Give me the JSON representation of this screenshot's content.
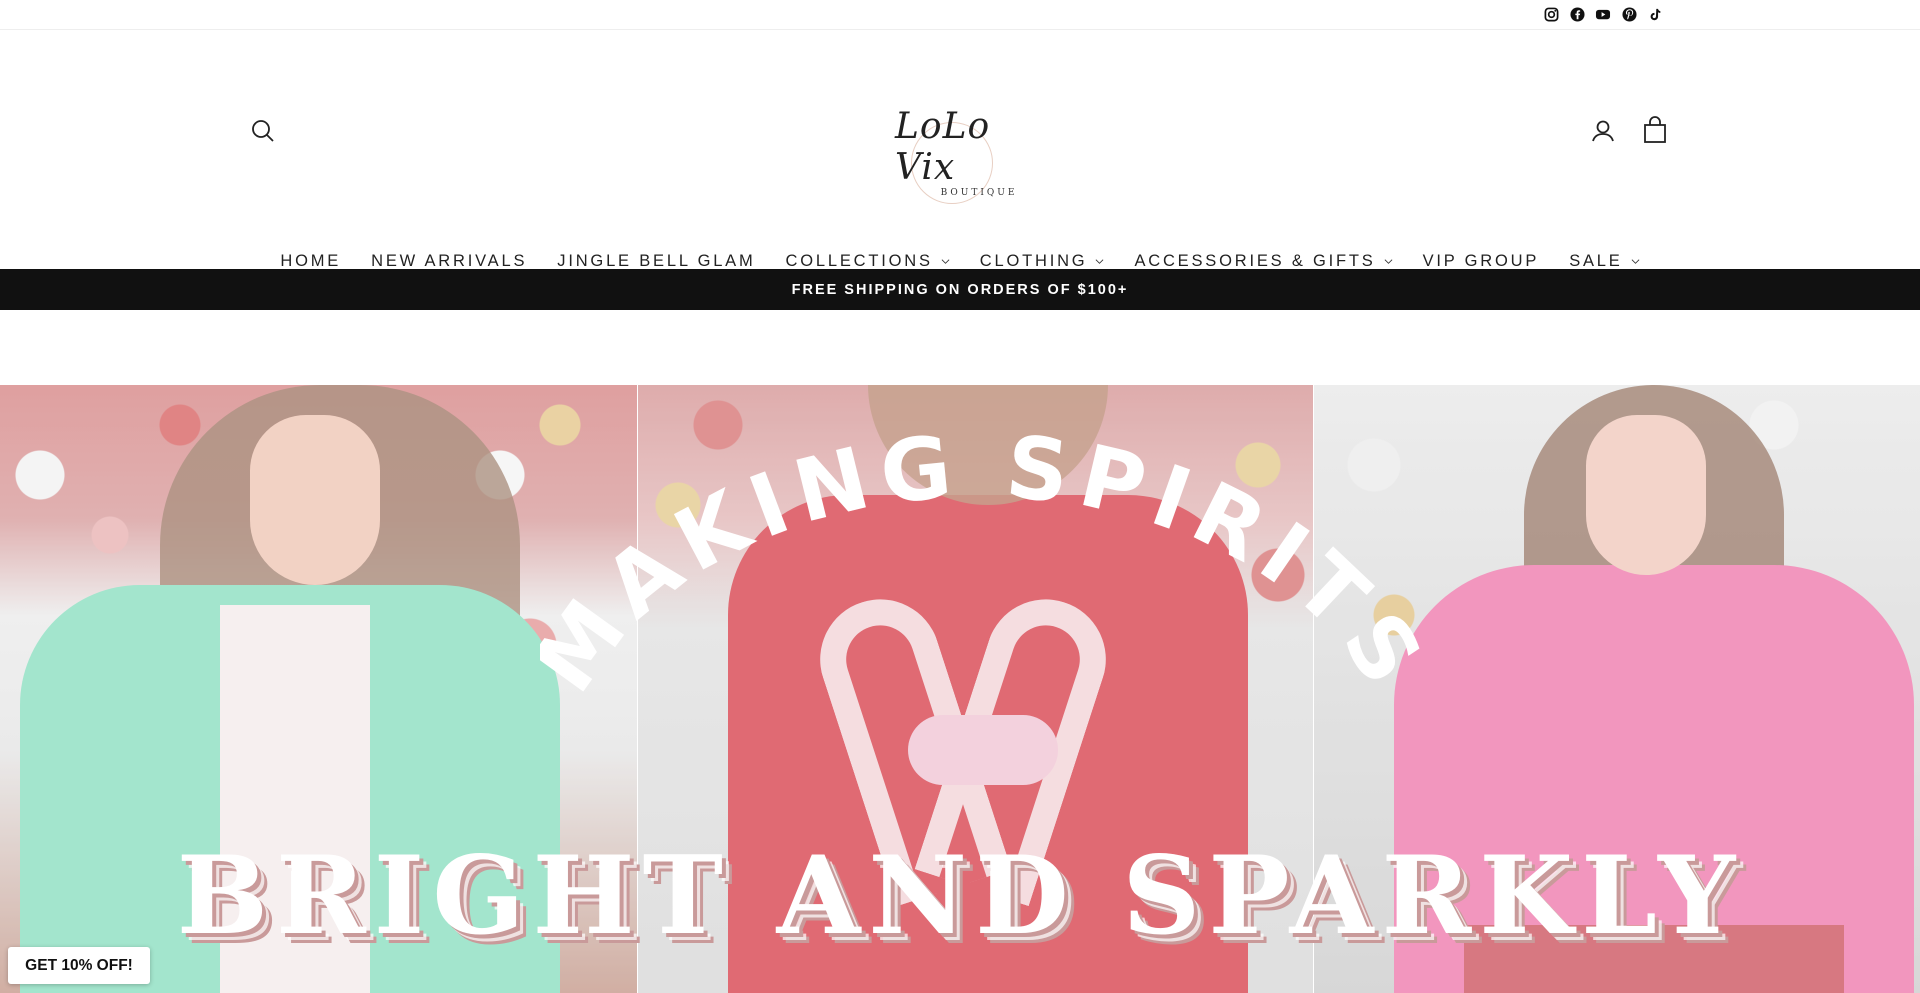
{
  "social": [
    {
      "name": "instagram-icon"
    },
    {
      "name": "facebook-icon"
    },
    {
      "name": "youtube-icon"
    },
    {
      "name": "pinterest-icon"
    },
    {
      "name": "tiktok-icon"
    }
  ],
  "header": {
    "logo_script": "LoLo Vix",
    "logo_sub": "BOUTIQUE"
  },
  "nav": {
    "items": [
      {
        "label": "HOME",
        "dropdown": false
      },
      {
        "label": "NEW ARRIVALS",
        "dropdown": false
      },
      {
        "label": "JINGLE BELL GLAM",
        "dropdown": false
      },
      {
        "label": "COLLECTIONS",
        "dropdown": true
      },
      {
        "label": "CLOTHING",
        "dropdown": true
      },
      {
        "label": "ACCESSORIES & GIFTS",
        "dropdown": true
      },
      {
        "label": "VIP GROUP",
        "dropdown": false
      },
      {
        "label": "SALE",
        "dropdown": true
      }
    ]
  },
  "announcement": "FREE SHIPPING ON ORDERS OF $100+",
  "hero": {
    "arc_text": "MAKING SPIRITS",
    "title": "BRIGHT AND SPARKLY"
  },
  "promo": {
    "label": "GET 10% OFF!"
  },
  "colors": {
    "announce_bg": "#111111",
    "accent": "#c99a9a"
  }
}
